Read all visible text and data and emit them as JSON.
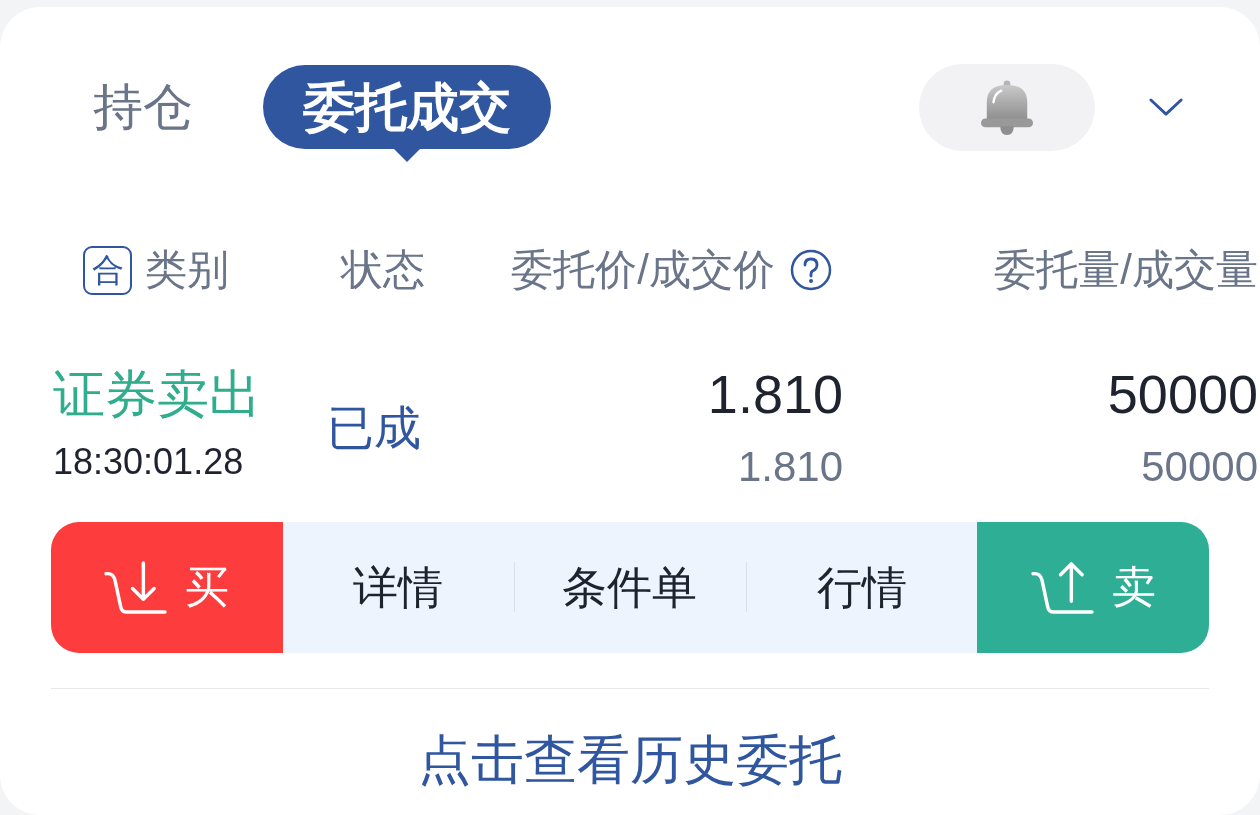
{
  "tabs": [
    {
      "label": "持仓",
      "selected": false
    },
    {
      "label": "委托成交",
      "selected": true
    }
  ],
  "table": {
    "merge_toggle": "合",
    "columns": [
      {
        "label": "类别",
        "help_icon": false
      },
      {
        "label": "状态",
        "help_icon": false
      },
      {
        "label": "委托价/成交价",
        "help_icon": true
      },
      {
        "label": "委托量/成交量",
        "help_icon": false
      }
    ],
    "rows": [
      {
        "category": "证券卖出",
        "color": "#30ad8c",
        "time": "18:30:01.28",
        "status": "已成",
        "order_price": "1.810",
        "filled_price": "1.810",
        "order_quantity": "50000",
        "filled_quantity": "50000"
      }
    ]
  },
  "actions": [
    {
      "kind": "buy",
      "label": "买"
    },
    {
      "kind": "link",
      "label": "详情"
    },
    {
      "kind": "link",
      "label": "条件单"
    },
    {
      "kind": "link",
      "label": "行情"
    },
    {
      "kind": "sell",
      "label": "卖"
    }
  ],
  "history_link": "点击查看历史委托"
}
